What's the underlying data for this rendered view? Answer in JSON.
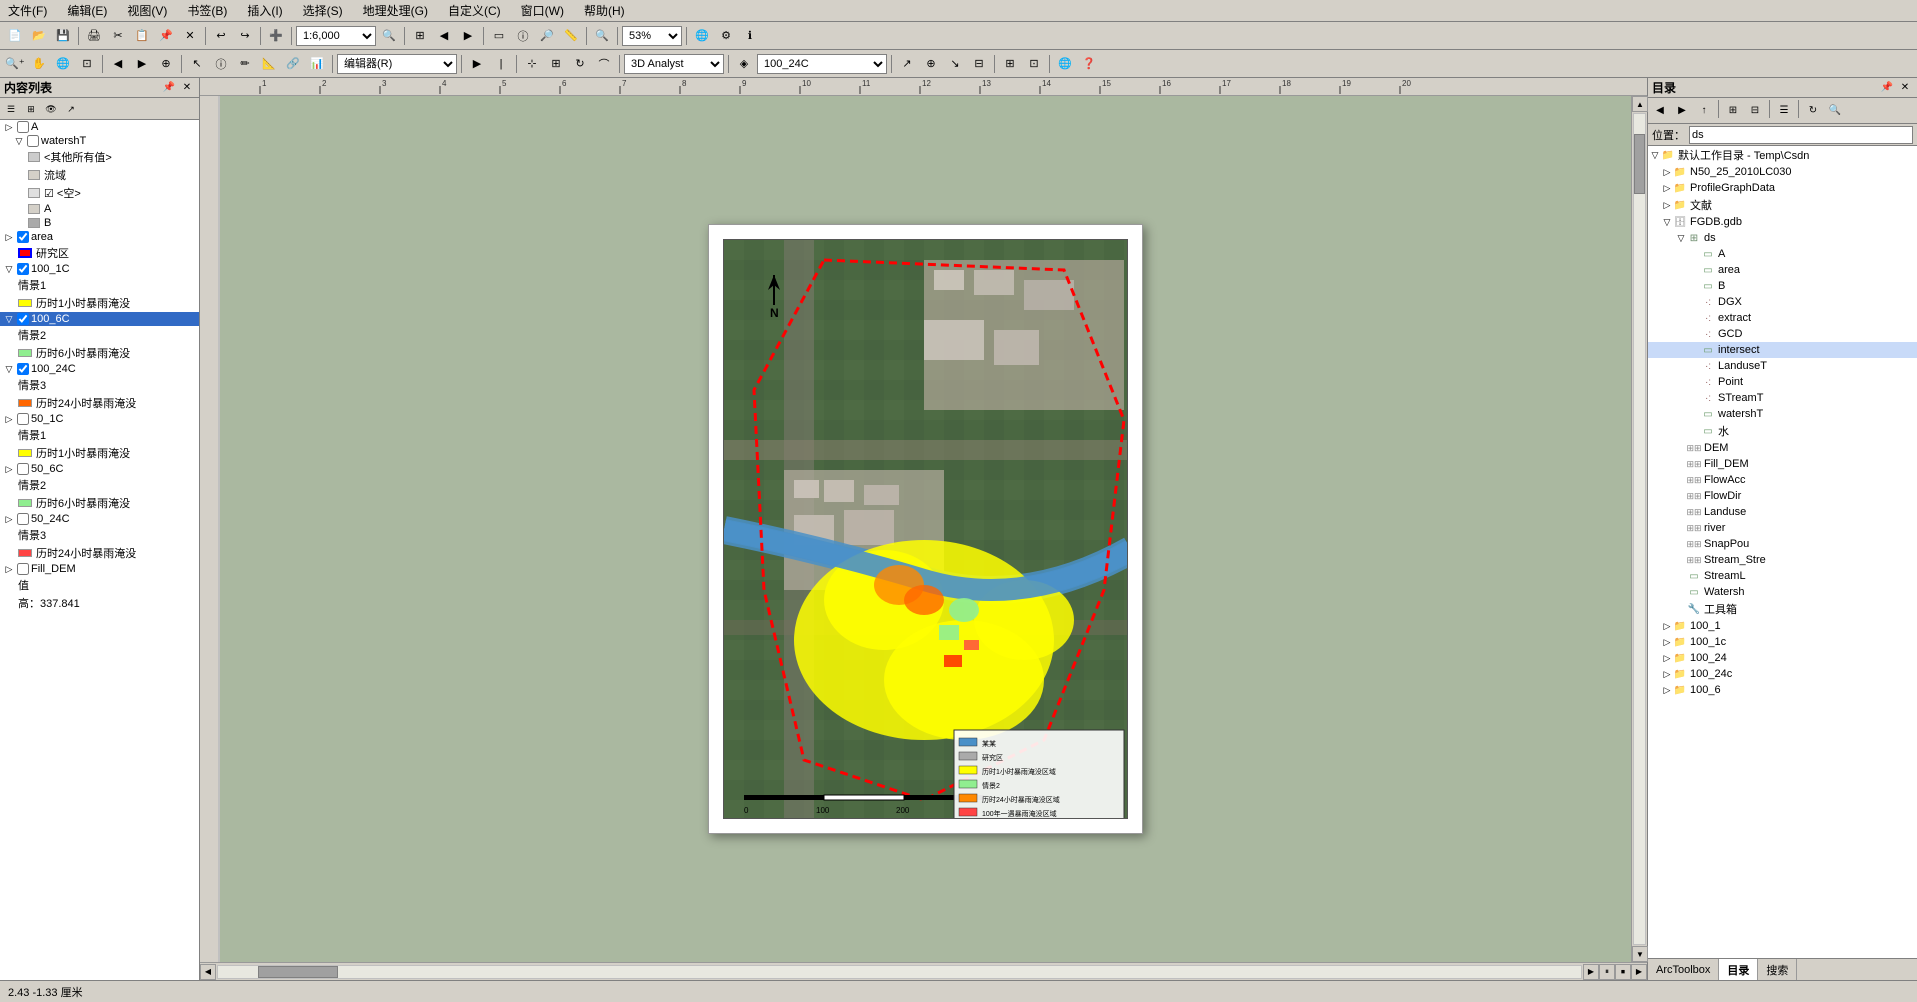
{
  "menu": {
    "items": [
      "文件(F)",
      "编辑(E)",
      "视图(V)",
      "书签(B)",
      "插入(I)",
      "选择(S)",
      "地理处理(G)",
      "自定义(C)",
      "窗口(W)",
      "帮助(H)"
    ]
  },
  "toolbar1": {
    "scale": "1:6,000",
    "zoom_percent": "53%"
  },
  "toolbar2": {
    "editor_label": "编辑器(R)",
    "analyst_label": "3D Analyst",
    "layer_label": "100_24C"
  },
  "left_panel": {
    "title": "内容列表",
    "items": [
      {
        "indent": 0,
        "checked": null,
        "label": "A",
        "type": "folder",
        "expanded": false
      },
      {
        "indent": 1,
        "checked": false,
        "label": "watershT",
        "type": "layer",
        "expanded": true
      },
      {
        "indent": 2,
        "checked": null,
        "label": "<其他所有值>",
        "type": "class"
      },
      {
        "indent": 2,
        "checked": null,
        "label": "流域",
        "type": "value"
      },
      {
        "indent": 2,
        "checked": null,
        "label": "<空>",
        "type": "class"
      },
      {
        "indent": 2,
        "checked": null,
        "label": "A",
        "type": "value"
      },
      {
        "indent": 2,
        "checked": null,
        "label": "B",
        "type": "value"
      },
      {
        "indent": 0,
        "checked": true,
        "label": "area",
        "type": "layer",
        "expanded": false
      },
      {
        "indent": 1,
        "checked": null,
        "label": "研究区",
        "type": "value",
        "color": "#ff0000"
      },
      {
        "indent": 0,
        "checked": true,
        "label": "100_1C",
        "type": "layer",
        "expanded": true
      },
      {
        "indent": 1,
        "checked": null,
        "label": "情景1",
        "type": "value"
      },
      {
        "indent": 1,
        "checked": null,
        "label": "历时1小时暴雨淹没",
        "type": "value",
        "color": "#ffff00"
      },
      {
        "indent": 0,
        "checked": true,
        "label": "100_6C",
        "type": "layer",
        "expanded": true,
        "selected": true
      },
      {
        "indent": 1,
        "checked": null,
        "label": "情景2",
        "type": "value"
      },
      {
        "indent": 1,
        "checked": null,
        "label": "历时6小时暴雨淹没",
        "type": "value",
        "color": "#90ee90"
      },
      {
        "indent": 0,
        "checked": true,
        "label": "100_24C",
        "type": "layer",
        "expanded": true
      },
      {
        "indent": 1,
        "checked": null,
        "label": "情景3",
        "type": "value"
      },
      {
        "indent": 1,
        "checked": null,
        "label": "历时24小时暴雨淹没",
        "type": "value",
        "color": "#ff6600"
      },
      {
        "indent": 0,
        "checked": false,
        "label": "50_1C",
        "type": "layer",
        "expanded": true
      },
      {
        "indent": 1,
        "checked": null,
        "label": "情景1",
        "type": "value"
      },
      {
        "indent": 1,
        "checked": null,
        "label": "历时1小时暴雨淹没",
        "type": "value",
        "color": "#ffff00"
      },
      {
        "indent": 0,
        "checked": false,
        "label": "50_6C",
        "type": "layer",
        "expanded": true
      },
      {
        "indent": 1,
        "checked": null,
        "label": "情景2",
        "type": "value"
      },
      {
        "indent": 1,
        "checked": null,
        "label": "历时6小时暴雨淹没",
        "type": "value",
        "color": "#90ee90"
      },
      {
        "indent": 0,
        "checked": false,
        "label": "50_24C",
        "type": "layer",
        "expanded": true
      },
      {
        "indent": 1,
        "checked": null,
        "label": "情景3",
        "type": "value"
      },
      {
        "indent": 1,
        "checked": null,
        "label": "历时24小时暴雨淹没",
        "type": "value",
        "color": "#ff4444"
      },
      {
        "indent": 0,
        "checked": false,
        "label": "Fill_DEM",
        "type": "layer",
        "expanded": true
      },
      {
        "indent": 1,
        "checked": null,
        "label": "值",
        "type": "value"
      },
      {
        "indent": 1,
        "checked": null,
        "label": "高：337.841",
        "type": "value"
      }
    ]
  },
  "right_panel": {
    "title": "目录",
    "location_label": "位置：",
    "location_value": "ds",
    "catalog_items": [
      {
        "indent": 0,
        "label": "默认工作目录 - Temp\\Csdn",
        "type": "folder",
        "expanded": true
      },
      {
        "indent": 1,
        "label": "N50_25_2010LC030",
        "type": "folder",
        "expanded": false
      },
      {
        "indent": 1,
        "label": "ProfileGraphData",
        "type": "folder",
        "expanded": false
      },
      {
        "indent": 1,
        "label": "文献",
        "type": "folder",
        "expanded": false
      },
      {
        "indent": 1,
        "label": "FGDB.gdb",
        "type": "gdb",
        "expanded": true
      },
      {
        "indent": 2,
        "label": "ds",
        "type": "dataset",
        "expanded": true
      },
      {
        "indent": 3,
        "label": "A",
        "type": "feature"
      },
      {
        "indent": 3,
        "label": "area",
        "type": "feature"
      },
      {
        "indent": 3,
        "label": "B",
        "type": "feature"
      },
      {
        "indent": 3,
        "label": "DGX",
        "type": "feature"
      },
      {
        "indent": 3,
        "label": "extract",
        "type": "feature"
      },
      {
        "indent": 3,
        "label": "GCD",
        "type": "feature"
      },
      {
        "indent": 3,
        "label": "intersect",
        "type": "feature",
        "highlighted": true
      },
      {
        "indent": 3,
        "label": "LanduseT",
        "type": "feature"
      },
      {
        "indent": 3,
        "label": "Point",
        "type": "feature"
      },
      {
        "indent": 3,
        "label": "STreamT",
        "type": "feature"
      },
      {
        "indent": 3,
        "label": "watershT",
        "type": "feature"
      },
      {
        "indent": 3,
        "label": "水",
        "type": "feature"
      },
      {
        "indent": 2,
        "label": "DEM",
        "type": "raster"
      },
      {
        "indent": 2,
        "label": "Fill_DEM",
        "type": "raster"
      },
      {
        "indent": 2,
        "label": "FlowAcc",
        "type": "raster"
      },
      {
        "indent": 2,
        "label": "FlowDir",
        "type": "raster"
      },
      {
        "indent": 2,
        "label": "Landuse",
        "type": "raster"
      },
      {
        "indent": 2,
        "label": "river",
        "type": "raster"
      },
      {
        "indent": 2,
        "label": "SnapPou",
        "type": "raster"
      },
      {
        "indent": 2,
        "label": "Stream_Stre",
        "type": "raster"
      },
      {
        "indent": 2,
        "label": "StreamL",
        "type": "feature"
      },
      {
        "indent": 2,
        "label": "Watersh",
        "type": "feature"
      },
      {
        "indent": 2,
        "label": "工具箱",
        "type": "toolbox"
      },
      {
        "indent": 1,
        "label": "100_1",
        "type": "folder",
        "expanded": false
      },
      {
        "indent": 1,
        "label": "100_1c",
        "type": "folder",
        "expanded": false
      },
      {
        "indent": 1,
        "label": "100_24",
        "type": "folder",
        "expanded": false
      },
      {
        "indent": 1,
        "label": "100_24c",
        "type": "folder",
        "expanded": false
      },
      {
        "indent": 1,
        "label": "100_6",
        "type": "folder",
        "expanded": false
      }
    ],
    "bottom_tabs": [
      "ArcToolbox",
      "目录",
      "搜索"
    ]
  },
  "status_bar": {
    "coordinates": "2.43  -1.33  厘米"
  },
  "map": {
    "north_arrow": "N",
    "scale_text": "0    100   200"
  }
}
